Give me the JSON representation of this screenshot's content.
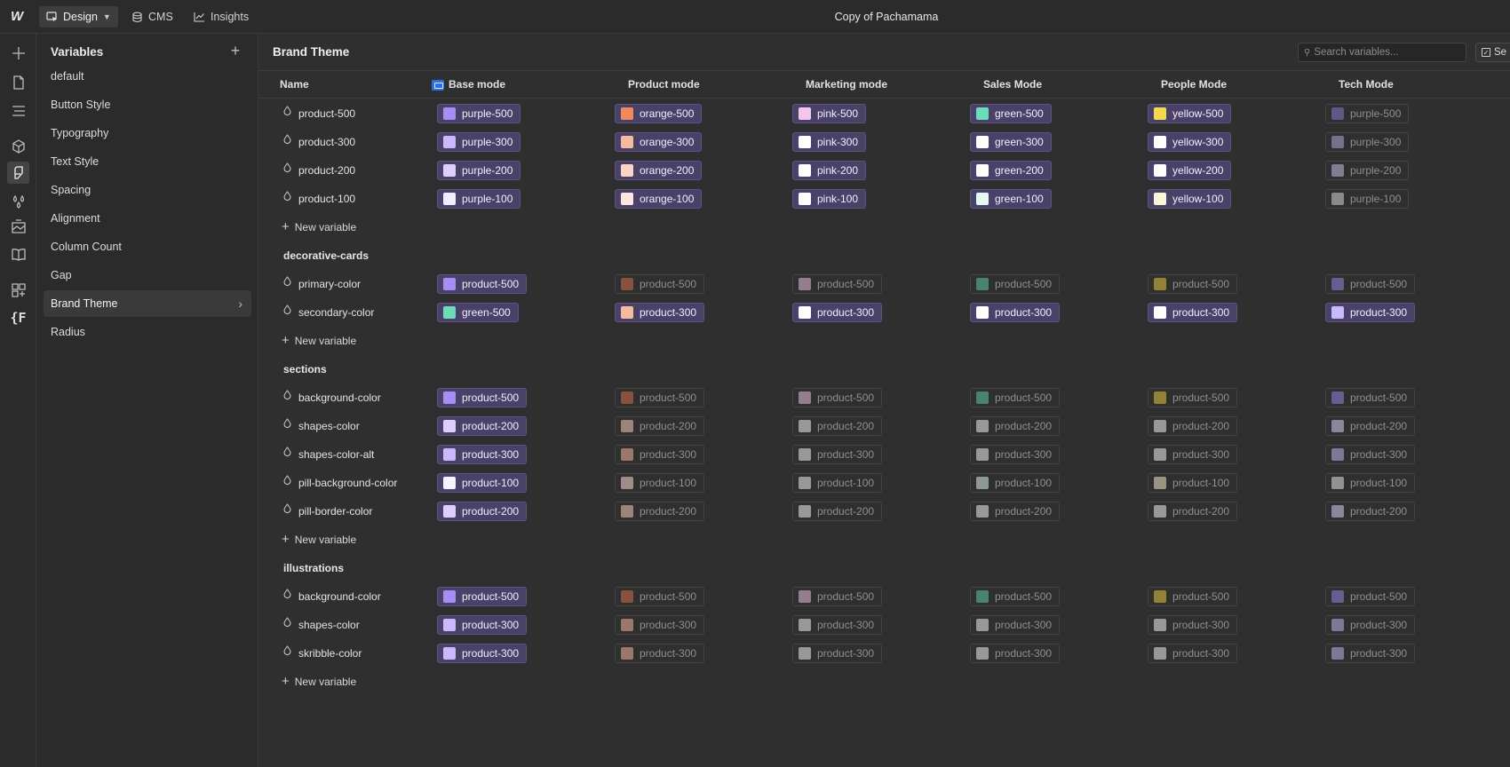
{
  "topbar": {
    "logo": "W",
    "design_label": "Design",
    "cms_label": "CMS",
    "insights_label": "Insights",
    "project_title": "Copy of Pachamama"
  },
  "panel": {
    "title": "Variables",
    "collections": [
      {
        "label": "default"
      },
      {
        "label": "Button Style"
      },
      {
        "label": "Typography"
      },
      {
        "label": "Text Style"
      },
      {
        "label": "Spacing"
      },
      {
        "label": "Alignment"
      },
      {
        "label": "Column Count"
      },
      {
        "label": "Gap"
      },
      {
        "label": "Brand Theme",
        "active": true
      },
      {
        "label": "Radius"
      }
    ]
  },
  "main": {
    "title": "Brand Theme",
    "search_placeholder": "Search variables...",
    "select_label": "Se",
    "columns": [
      "Name",
      "Base mode",
      "Product mode",
      "Marketing mode",
      "Sales Mode",
      "People Mode",
      "Tech Mode"
    ],
    "new_variable_label": "New variable"
  },
  "rows": [
    {
      "kind": "var",
      "name": "product-500",
      "cells": [
        {
          "label": "purple-500",
          "color": "#a98cf5",
          "on": true
        },
        {
          "label": "orange-500",
          "color": "#f08a5d",
          "on": true
        },
        {
          "label": "pink-500",
          "color": "#f4c6ec",
          "on": true
        },
        {
          "label": "green-500",
          "color": "#6cdbb9",
          "on": true
        },
        {
          "label": "yellow-500",
          "color": "#f5d94a",
          "on": true
        },
        {
          "label": "purple-500",
          "color": "#8c77c9",
          "on": false
        }
      ]
    },
    {
      "kind": "var",
      "name": "product-300",
      "cells": [
        {
          "label": "purple-300",
          "color": "#c9b8fa",
          "on": true
        },
        {
          "label": "orange-300",
          "color": "#f7b9a0",
          "on": true
        },
        {
          "label": "pink-300",
          "color": "#ffffff",
          "on": true
        },
        {
          "label": "green-300",
          "color": "#ffffff",
          "on": true
        },
        {
          "label": "yellow-300",
          "color": "#ffffff",
          "on": true
        },
        {
          "label": "purple-300",
          "color": "#b3a6d9",
          "on": false
        }
      ]
    },
    {
      "kind": "var",
      "name": "product-200",
      "cells": [
        {
          "label": "purple-200",
          "color": "#dccffb",
          "on": true
        },
        {
          "label": "orange-200",
          "color": "#fad5c5",
          "on": true
        },
        {
          "label": "pink-200",
          "color": "#ffffff",
          "on": true
        },
        {
          "label": "green-200",
          "color": "#ffffff",
          "on": true
        },
        {
          "label": "yellow-200",
          "color": "#ffffff",
          "on": true
        },
        {
          "label": "purple-200",
          "color": "#c7c0dc",
          "on": false
        }
      ]
    },
    {
      "kind": "var",
      "name": "product-100",
      "cells": [
        {
          "label": "purple-100",
          "color": "#f1ecfe",
          "on": true
        },
        {
          "label": "orange-100",
          "color": "#fde8df",
          "on": true
        },
        {
          "label": "pink-100",
          "color": "#ffffff",
          "on": true
        },
        {
          "label": "green-100",
          "color": "#e3faf4",
          "on": true
        },
        {
          "label": "yellow-100",
          "color": "#fdf6d4",
          "on": true
        },
        {
          "label": "purple-100",
          "color": "#d6d2df",
          "on": false
        }
      ]
    },
    {
      "kind": "new"
    },
    {
      "kind": "group",
      "title": "decorative-cards"
    },
    {
      "kind": "var",
      "name": "primary-color",
      "cells": [
        {
          "label": "product-500",
          "color": "#a98cf5",
          "on": true
        },
        {
          "label": "product-500",
          "color": "#d46e4e",
          "on": false
        },
        {
          "label": "product-500",
          "color": "#e9bbe2",
          "on": false
        },
        {
          "label": "product-500",
          "color": "#5fc7a6",
          "on": false
        },
        {
          "label": "product-500",
          "color": "#e1c63a",
          "on": false
        },
        {
          "label": "product-500",
          "color": "#9a80e6",
          "on": false
        }
      ]
    },
    {
      "kind": "var",
      "name": "secondary-color",
      "cells": [
        {
          "label": "green-500",
          "color": "#6cdbb9",
          "on": true
        },
        {
          "label": "product-300",
          "color": "#f7b9a0",
          "on": true
        },
        {
          "label": "product-300",
          "color": "#ffffff",
          "on": true
        },
        {
          "label": "product-300",
          "color": "#ffffff",
          "on": true
        },
        {
          "label": "product-300",
          "color": "#ffffff",
          "on": true
        },
        {
          "label": "product-300",
          "color": "#c9b8fa",
          "on": true
        }
      ]
    },
    {
      "kind": "new"
    },
    {
      "kind": "group",
      "title": "sections"
    },
    {
      "kind": "var",
      "name": "background-color",
      "cells": [
        {
          "label": "product-500",
          "color": "#a98cf5",
          "on": true
        },
        {
          "label": "product-500",
          "color": "#d46e4e",
          "on": false
        },
        {
          "label": "product-500",
          "color": "#e9bbe2",
          "on": false
        },
        {
          "label": "product-500",
          "color": "#5fc7a6",
          "on": false
        },
        {
          "label": "product-500",
          "color": "#e1c63a",
          "on": false
        },
        {
          "label": "product-500",
          "color": "#9a80e6",
          "on": false
        }
      ]
    },
    {
      "kind": "var",
      "name": "shapes-color",
      "cells": [
        {
          "label": "product-200",
          "color": "#dccffb",
          "on": true
        },
        {
          "label": "product-200",
          "color": "#f2c9b8",
          "on": false
        },
        {
          "label": "product-200",
          "color": "#eeeeee",
          "on": false
        },
        {
          "label": "product-200",
          "color": "#eeeeee",
          "on": false
        },
        {
          "label": "product-200",
          "color": "#eeeeee",
          "on": false
        },
        {
          "label": "product-200",
          "color": "#d5cdef",
          "on": false
        }
      ]
    },
    {
      "kind": "var",
      "name": "shapes-color-alt",
      "cells": [
        {
          "label": "product-300",
          "color": "#c9b8fa",
          "on": true
        },
        {
          "label": "product-300",
          "color": "#f2b49c",
          "on": false
        },
        {
          "label": "product-300",
          "color": "#eeeeee",
          "on": false
        },
        {
          "label": "product-300",
          "color": "#eeeeee",
          "on": false
        },
        {
          "label": "product-300",
          "color": "#eeeeee",
          "on": false
        },
        {
          "label": "product-300",
          "color": "#c1b2ef",
          "on": false
        }
      ]
    },
    {
      "kind": "var",
      "name": "pill-background-color",
      "cells": [
        {
          "label": "product-100",
          "color": "#f6f2ff",
          "on": true
        },
        {
          "label": "product-100",
          "color": "#f4ddd3",
          "on": false
        },
        {
          "label": "product-100",
          "color": "#eeeeee",
          "on": false
        },
        {
          "label": "product-100",
          "color": "#dcefe9",
          "on": false
        },
        {
          "label": "product-100",
          "color": "#efe7c4",
          "on": false
        },
        {
          "label": "product-100",
          "color": "#e4e1ee",
          "on": false
        }
      ]
    },
    {
      "kind": "var",
      "name": "pill-border-color",
      "cells": [
        {
          "label": "product-200",
          "color": "#dccffb",
          "on": true
        },
        {
          "label": "product-200",
          "color": "#f2c9b8",
          "on": false
        },
        {
          "label": "product-200",
          "color": "#eeeeee",
          "on": false
        },
        {
          "label": "product-200",
          "color": "#eeeeee",
          "on": false
        },
        {
          "label": "product-200",
          "color": "#eeeeee",
          "on": false
        },
        {
          "label": "product-200",
          "color": "#d5cdef",
          "on": false
        }
      ]
    },
    {
      "kind": "new"
    },
    {
      "kind": "group",
      "title": "illustrations"
    },
    {
      "kind": "var",
      "name": "background-color",
      "cells": [
        {
          "label": "product-500",
          "color": "#a98cf5",
          "on": true
        },
        {
          "label": "product-500",
          "color": "#d46e4e",
          "on": false
        },
        {
          "label": "product-500",
          "color": "#e9bbe2",
          "on": false
        },
        {
          "label": "product-500",
          "color": "#5fc7a6",
          "on": false
        },
        {
          "label": "product-500",
          "color": "#e1c63a",
          "on": false
        },
        {
          "label": "product-500",
          "color": "#9a80e6",
          "on": false
        }
      ]
    },
    {
      "kind": "var",
      "name": "shapes-color",
      "cells": [
        {
          "label": "product-300",
          "color": "#c9b8fa",
          "on": true
        },
        {
          "label": "product-300",
          "color": "#f2b49c",
          "on": false
        },
        {
          "label": "product-300",
          "color": "#eeeeee",
          "on": false
        },
        {
          "label": "product-300",
          "color": "#eeeeee",
          "on": false
        },
        {
          "label": "product-300",
          "color": "#eeeeee",
          "on": false
        },
        {
          "label": "product-300",
          "color": "#c1b2ef",
          "on": false
        }
      ]
    },
    {
      "kind": "var",
      "name": "skribble-color",
      "cells": [
        {
          "label": "product-300",
          "color": "#c9b8fa",
          "on": true
        },
        {
          "label": "product-300",
          "color": "#f2b49c",
          "on": false
        },
        {
          "label": "product-300",
          "color": "#eeeeee",
          "on": false
        },
        {
          "label": "product-300",
          "color": "#eeeeee",
          "on": false
        },
        {
          "label": "product-300",
          "color": "#eeeeee",
          "on": false
        },
        {
          "label": "product-300",
          "color": "#c1b2ef",
          "on": false
        }
      ]
    },
    {
      "kind": "new"
    }
  ],
  "rail_icons": [
    "add-icon",
    "pages-icon",
    "navigator-icon",
    "components-icon",
    "style-icon",
    "assets-drops-icon",
    "image-icon",
    "book-icon",
    "apps-icon",
    "variables-f-icon"
  ],
  "colors": {
    "accent": "#4a4168",
    "active_chip_border": "#5d5380",
    "base_mode_icon": "#2f6fe0"
  }
}
